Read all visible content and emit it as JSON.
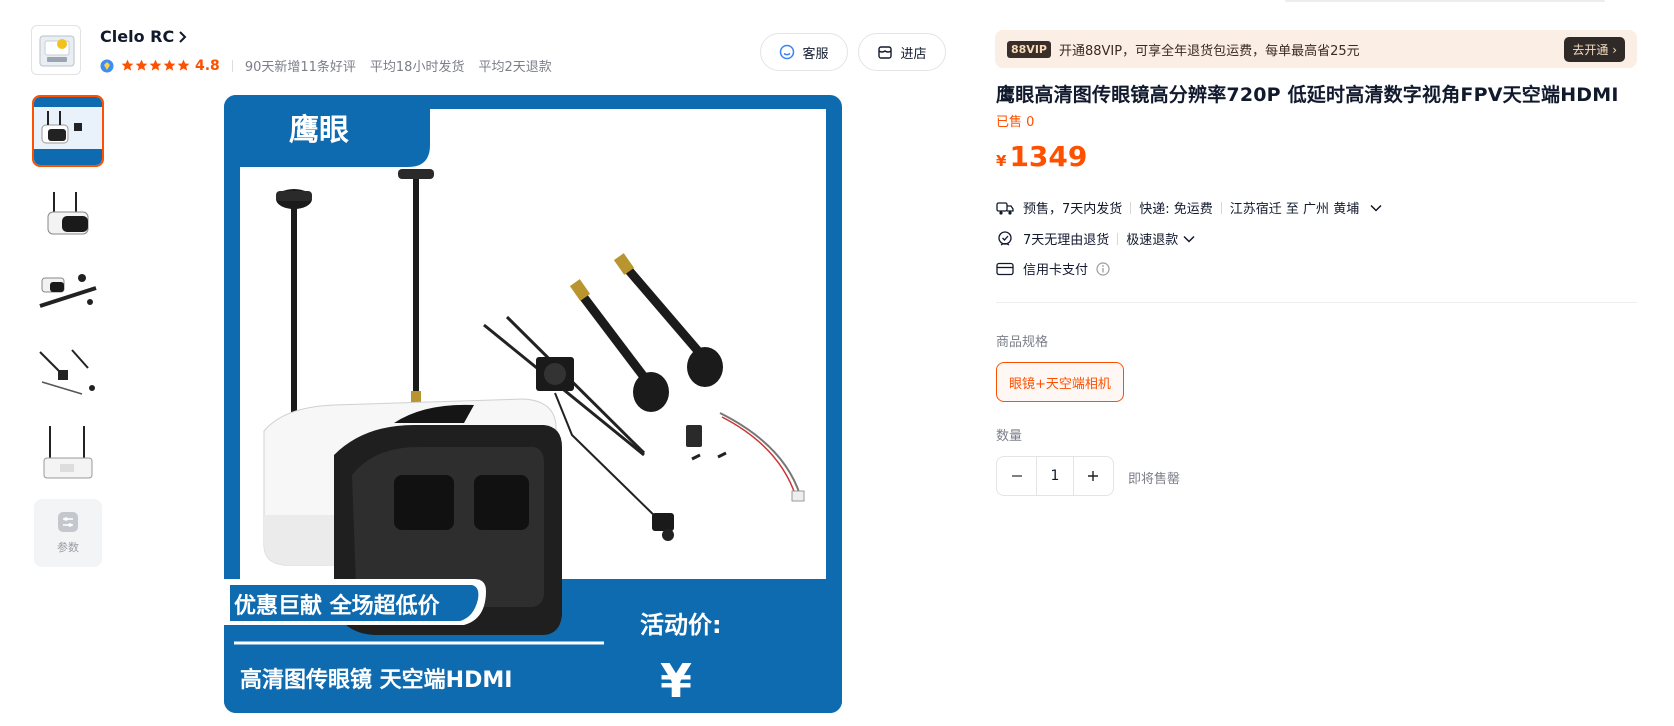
{
  "shop": {
    "name": "Clelo RC",
    "rating": "4.8",
    "stats": [
      "90天新增11条好评",
      "平均18小时发货",
      "平均2天退款"
    ],
    "service_label": "客服",
    "visit_label": "进店"
  },
  "gallery": {
    "thumbnail_count": 5,
    "params_label": "参数",
    "main_image": {
      "headline": "鹰眼",
      "promo": "优惠巨献  全场超低价",
      "subtitle": "高清图传眼镜 天空端HDMI",
      "activity_label": "活动价:",
      "currency": "¥"
    }
  },
  "vip": {
    "tag": "88VIP",
    "text": "开通88VIP，可享全年退货包运费，每单最高省25元",
    "cta": "去开通 ›"
  },
  "product": {
    "title": "鹰眼高清图传眼镜高分辨率720P 低延时高清数字视角FPV天空端HDMI",
    "sold": "已售 0",
    "currency": "¥",
    "price": "1349"
  },
  "delivery": {
    "presale": "预售，7天内发货",
    "shipping": "快递: 免运费",
    "route": "江苏宿迁 至 广州 黄埔"
  },
  "guarantee": {
    "returns": "7天无理由退货",
    "refund": "极速退款"
  },
  "payment": {
    "method": "信用卡支付"
  },
  "spec": {
    "label": "商品规格",
    "selected": "眼镜+天空端相机"
  },
  "quantity": {
    "label": "数量",
    "value": "1",
    "stock_note": "即将售罄"
  },
  "colors": {
    "accent": "#ff5000",
    "brand_blue": "#0f6bb0",
    "text": "#11192d",
    "muted": "#7c7f89"
  }
}
